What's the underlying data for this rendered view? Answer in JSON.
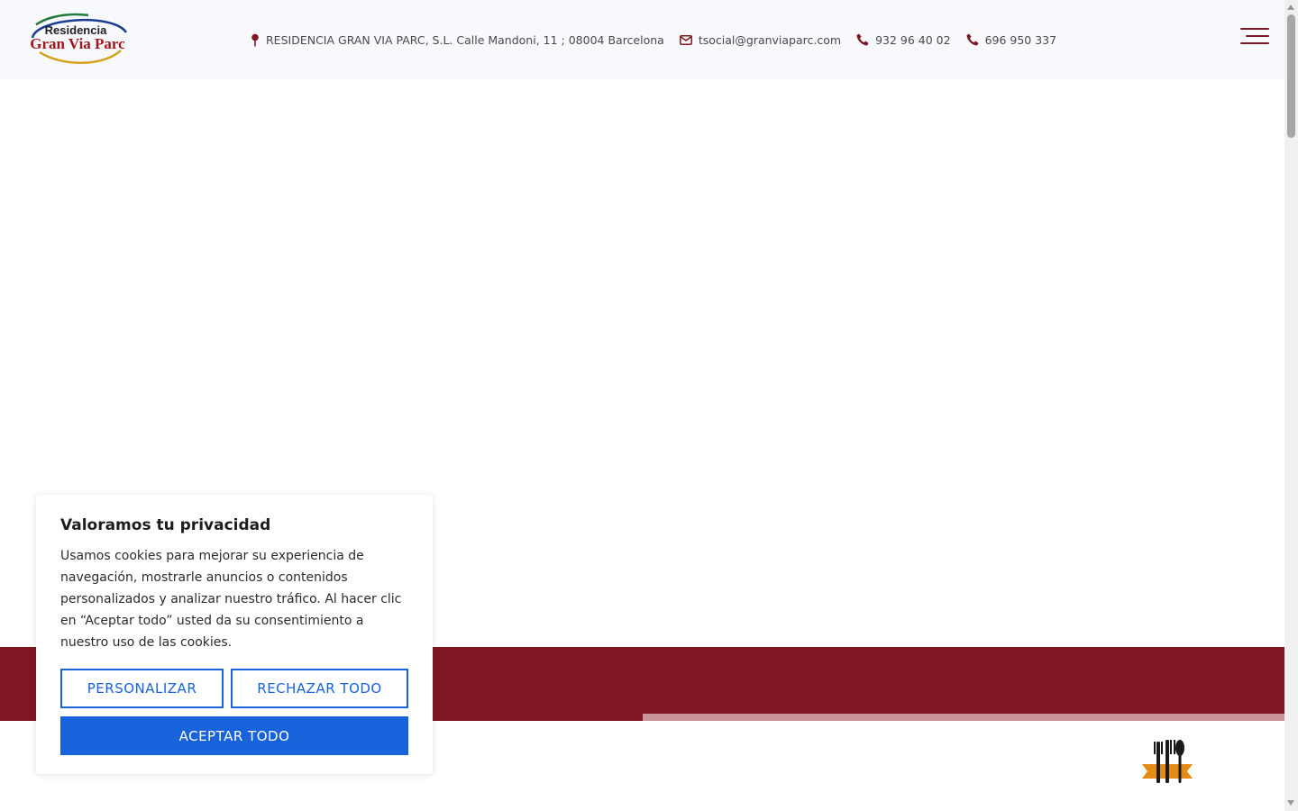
{
  "header": {
    "logo": {
      "line1": "Residencia",
      "line2": "Gran Via Parc"
    },
    "address": "RESIDENCIA GRAN VIA PARC, S.L. Calle Mandoni, 11 ; 08004 Barcelona",
    "email": "tsocial@granviaparc.com",
    "phone1": "932 96 40 02",
    "phone2": "696 950 337",
    "menu_icon": "hamburger-menu-icon"
  },
  "cookie_banner": {
    "title": "Valoramos tu privacidad",
    "text": "Usamos cookies para mejorar su experiencia de navegación, mostrarle anuncios o contenidos personalizados y analizar nuestro tráfico. Al hacer clic en “Aceptar todo” usted da su consentimiento a nuestro uso de las cookies.",
    "customize_label": "PERSONALIZAR",
    "reject_label": "RECHAZAR TODO",
    "accept_label": "ACEPTAR TODO"
  },
  "colors": {
    "brand": "#7f1722",
    "brand_light": "#c9939a",
    "button_blue": "#1863dc",
    "header_bg": "#f7f9fd"
  },
  "icons": [
    "map-pin-icon",
    "envelope-icon",
    "phone-icon",
    "cutlery-icon"
  ]
}
